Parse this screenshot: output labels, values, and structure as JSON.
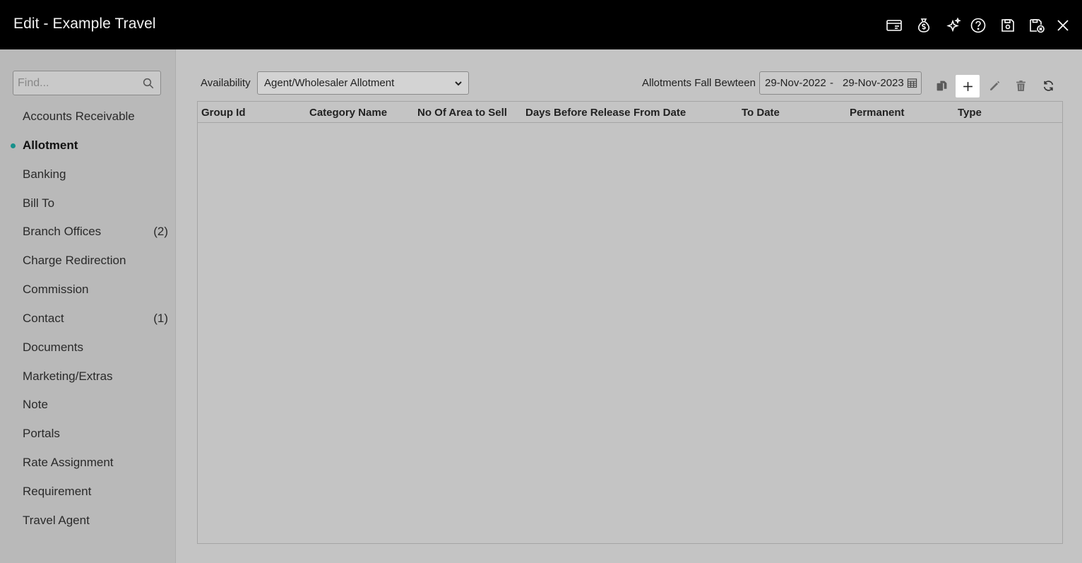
{
  "window": {
    "title": "Edit - Example Travel",
    "icons": [
      "card-icon",
      "money-bag-icon",
      "sparkle-icon",
      "help-icon",
      "save-icon",
      "save-close-icon",
      "close-icon"
    ]
  },
  "sidebar": {
    "search_placeholder": "Find...",
    "items": [
      {
        "label": "Accounts Receivable",
        "count": ""
      },
      {
        "label": "Allotment",
        "count": "",
        "active": true
      },
      {
        "label": "Banking",
        "count": ""
      },
      {
        "label": "Bill To",
        "count": ""
      },
      {
        "label": "Branch Offices",
        "count": "(2)"
      },
      {
        "label": "Charge Redirection",
        "count": ""
      },
      {
        "label": "Commission",
        "count": ""
      },
      {
        "label": "Contact",
        "count": "(1)"
      },
      {
        "label": "Documents",
        "count": ""
      },
      {
        "label": "Marketing/Extras",
        "count": ""
      },
      {
        "label": "Note",
        "count": ""
      },
      {
        "label": "Portals",
        "count": ""
      },
      {
        "label": "Rate Assignment",
        "count": ""
      },
      {
        "label": "Requirement",
        "count": ""
      },
      {
        "label": "Travel Agent",
        "count": ""
      }
    ],
    "active_color": "#17918b"
  },
  "toolbar": {
    "availability_label": "Availability",
    "availability_value": "Agent/Wholesaler Allotment",
    "range_label": "Allotments Fall Bewteen",
    "date_from": "29-Nov-2022",
    "date_sep": "-",
    "date_to": "29-Nov-2023"
  },
  "grid": {
    "columns": [
      "Group Id",
      "Category Name",
      "No Of Area to Sell",
      "Days Before Release",
      "From Date",
      "To Date",
      "Permanent",
      "Type"
    ],
    "rows": []
  }
}
